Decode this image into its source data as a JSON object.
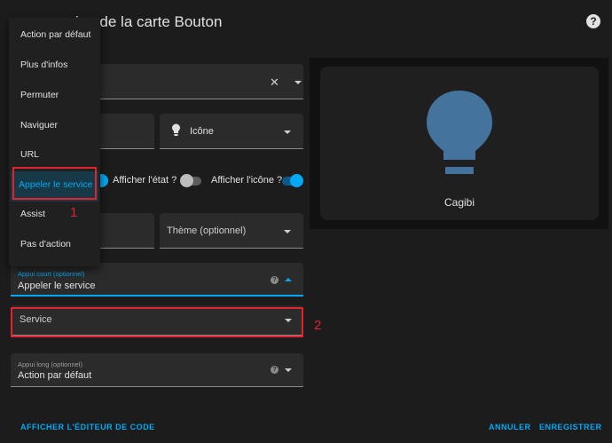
{
  "dialog": {
    "title": "ion de la carte Bouton"
  },
  "fields": {
    "entity_value": "",
    "name_value": "",
    "icon_label": "Icône",
    "theme_placeholder": "Thème (optionnel)",
    "height_value": "",
    "tap_action": {
      "label": "Appui court (optionnel)",
      "value": "Appeler le service"
    },
    "service": {
      "label": "Service"
    },
    "hold_action": {
      "label": "Appui long (optionnel)",
      "value": "Action par défaut"
    }
  },
  "toggles": {
    "show_state": {
      "label": "Afficher l'état ?",
      "on": false
    },
    "show_icon": {
      "label": "Afficher l'icône ?",
      "on": true
    }
  },
  "preview": {
    "name": "Cagibi",
    "icon": "lightbulb-icon",
    "icon_color": "#44739e"
  },
  "menu": {
    "items": [
      {
        "label": "Action par défaut",
        "selected": false
      },
      {
        "label": "Plus d'infos",
        "selected": false
      },
      {
        "label": "Permuter",
        "selected": false
      },
      {
        "label": "Naviguer",
        "selected": false
      },
      {
        "label": "URL",
        "selected": false
      },
      {
        "label": "Appeler le service",
        "selected": true
      },
      {
        "label": "Assist",
        "selected": false
      },
      {
        "label": "Pas d'action",
        "selected": false
      }
    ]
  },
  "annotations": {
    "one": "1",
    "two": "2"
  },
  "footer": {
    "code_editor": "AFFICHER L'ÉDITEUR DE CODE",
    "cancel": "ANNULER",
    "save": "ENREGISTRER"
  },
  "colors": {
    "accent": "#03a9f4",
    "annotation": "#e3222b",
    "background": "#1c1c1c",
    "field": "#2b2b2b"
  }
}
